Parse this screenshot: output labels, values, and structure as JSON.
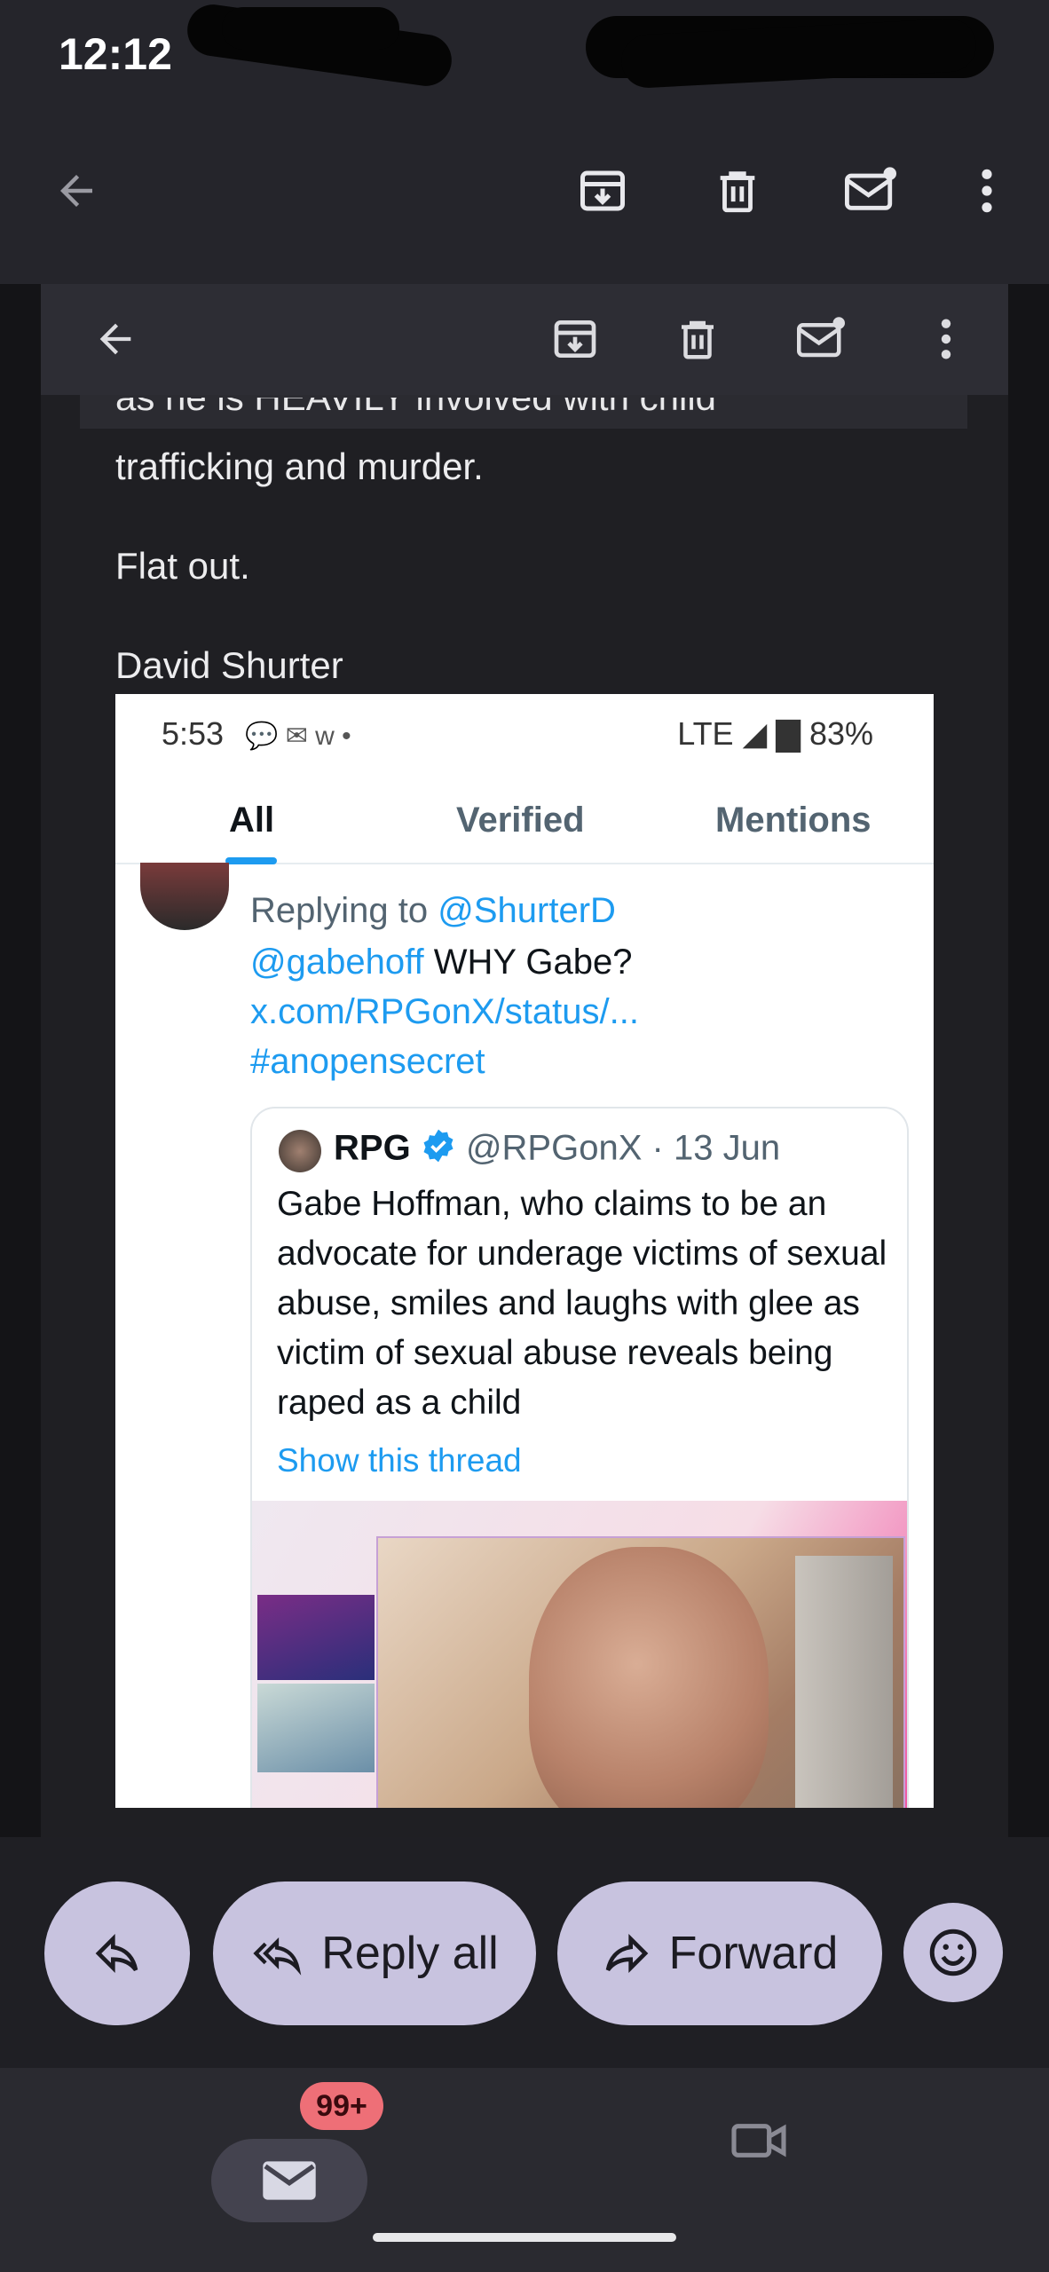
{
  "status_bar": {
    "time": "12:12"
  },
  "toolbar": {
    "back_icon": "arrow-left-icon",
    "archive_icon": "archive-icon",
    "delete_icon": "trash-icon",
    "mark_unread_icon": "mail-unread-icon",
    "more_icon": "more-vert-icon"
  },
  "email": {
    "clipped_line": "as he is HEAVILY involved with child",
    "line1": "trafficking and murder.",
    "line2": "Flat out.",
    "signature": "David Shurter"
  },
  "embedded_screenshot": {
    "status_time": "5:53",
    "status_icons": "💬 ✉ w •",
    "status_right": "LTE ◢ ▇ 83%",
    "tabs": [
      "All",
      "Verified",
      "Mentions"
    ],
    "active_tab": "All",
    "reply": {
      "replying_to_prefix": "Replying to ",
      "replying_to_handle": "@ShurterD",
      "mention": "@gabehoff",
      "text": " WHY Gabe?",
      "link": "x.com/RPGonX/status/...",
      "hashtag": "#anopensecret"
    },
    "quoted_tweet": {
      "name": "RPG",
      "handle": "@RPGonX",
      "date": "· 13 Jun",
      "text": "Gabe Hoffman, who claims to be an advocate for underage victims of sexual abuse, smiles and laughs with glee as victim of sexual abuse reveals being raped as a child",
      "show_thread": "Show this thread"
    }
  },
  "actions": {
    "reply_icon": "reply-icon",
    "reply_all_label": "Reply all",
    "forward_label": "Forward",
    "emoji_icon": "emoji-icon"
  },
  "bottom_nav": {
    "mail_badge": "99+",
    "mail_icon": "mail-icon",
    "meet_icon": "video-icon"
  },
  "colors": {
    "background": "#1f1f24",
    "pill": "#c8c3df",
    "badge": "#ee6f77",
    "twitter_blue": "#1d9bf0"
  }
}
